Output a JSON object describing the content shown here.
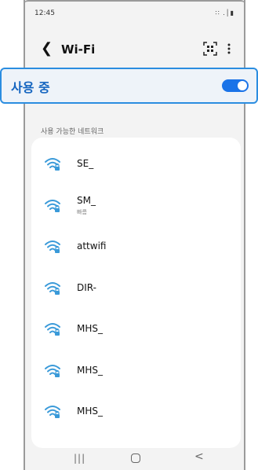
{
  "status_bar": {
    "time": "12:45",
    "icons": "∷ .│▮"
  },
  "app_bar": {
    "title": "Wi-Fi",
    "back_icon": "chevron-left",
    "qr_icon": "qr-scan",
    "more_icon": "more-vertical"
  },
  "master_toggle": {
    "label": "사용 중",
    "state": "on"
  },
  "section": {
    "header": "사용 가능한 네트워크"
  },
  "networks": [
    {
      "name": "SE_",
      "subtitle": ""
    },
    {
      "name": "SM_",
      "subtitle": "빠름"
    },
    {
      "name": "attwifi",
      "subtitle": ""
    },
    {
      "name": "DIR-",
      "subtitle": ""
    },
    {
      "name": "MHS_",
      "subtitle": ""
    },
    {
      "name": "MHS_",
      "subtitle": ""
    },
    {
      "name": "MHS_",
      "subtitle": ""
    }
  ],
  "nav_bar": {
    "recent": "|||",
    "back": "<"
  },
  "colors": {
    "accent": "#1a73e8",
    "toggle_bg": "#eef3f9",
    "wifi_icon": "#3a9ad9"
  }
}
